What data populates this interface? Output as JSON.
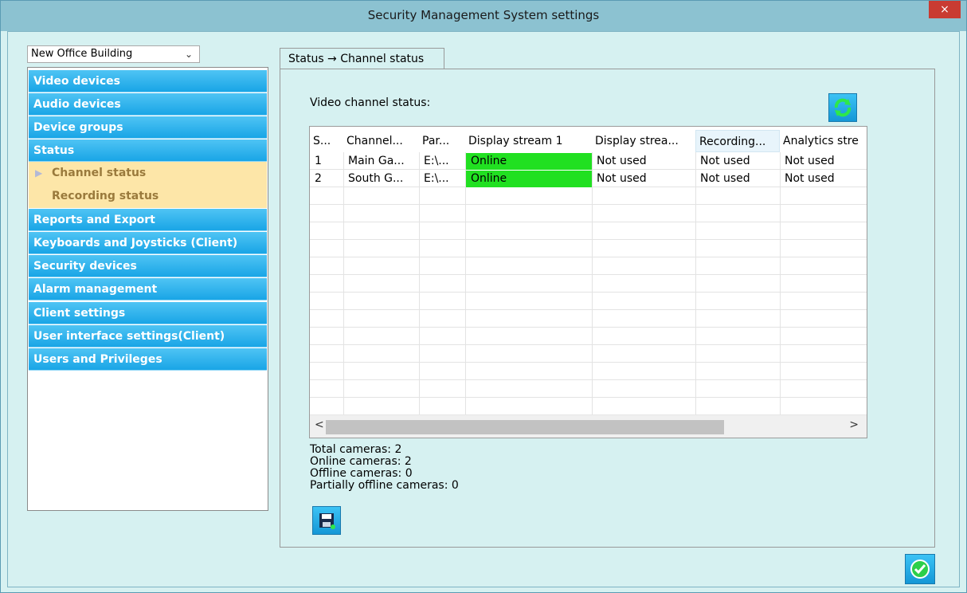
{
  "window": {
    "title": "Security Management System settings",
    "close_glyph": "×"
  },
  "site_selector": {
    "value": "New Office Building",
    "chevron": "⌄"
  },
  "nav": {
    "items": [
      {
        "label": "Video devices"
      },
      {
        "label": "Audio devices"
      },
      {
        "label": "Device groups"
      },
      {
        "label": "Status"
      },
      {
        "label": "Reports and Export"
      },
      {
        "label": "Keyboards and Joysticks (Client)"
      },
      {
        "label": "Security devices"
      },
      {
        "label": "Alarm management"
      },
      {
        "label": "Client settings"
      },
      {
        "label": "User interface settings(Client)"
      },
      {
        "label": "Users and Privileges"
      }
    ],
    "sub_items": [
      {
        "label": "Channel status",
        "selected": true
      },
      {
        "label": "Recording status",
        "selected": false
      }
    ]
  },
  "tab": {
    "label": "Status → Channel status"
  },
  "panel": {
    "title": "Video channel status:"
  },
  "table": {
    "headers": [
      "S...",
      "Channel...",
      "Par...",
      "Display stream 1",
      "Display strea...",
      "Recording...",
      "Analytics stre"
    ],
    "rows": [
      [
        "1",
        "Main Ga...",
        "E:\\...",
        "Online",
        "Not used",
        "Not used",
        "Not used"
      ],
      [
        "2",
        "South G...",
        "E:\\...",
        "Online",
        "Not used",
        "Not used",
        "Not used"
      ]
    ],
    "scroll_left": "<",
    "scroll_right": ">"
  },
  "stats": {
    "total": "Total cameras: 2",
    "online": "Online cameras: 2",
    "offline": "Offline cameras: 0",
    "partial": "Partially offline cameras: 0"
  },
  "icons": {
    "refresh": "refresh-icon",
    "save": "save-icon",
    "ok": "ok-check-icon",
    "selected_arrow": "▶"
  },
  "colors": {
    "nav_blue": "#19a5e6",
    "sub_item_bg": "#fde6a8",
    "online_green": "#21e021",
    "close_red": "#c93b32"
  }
}
